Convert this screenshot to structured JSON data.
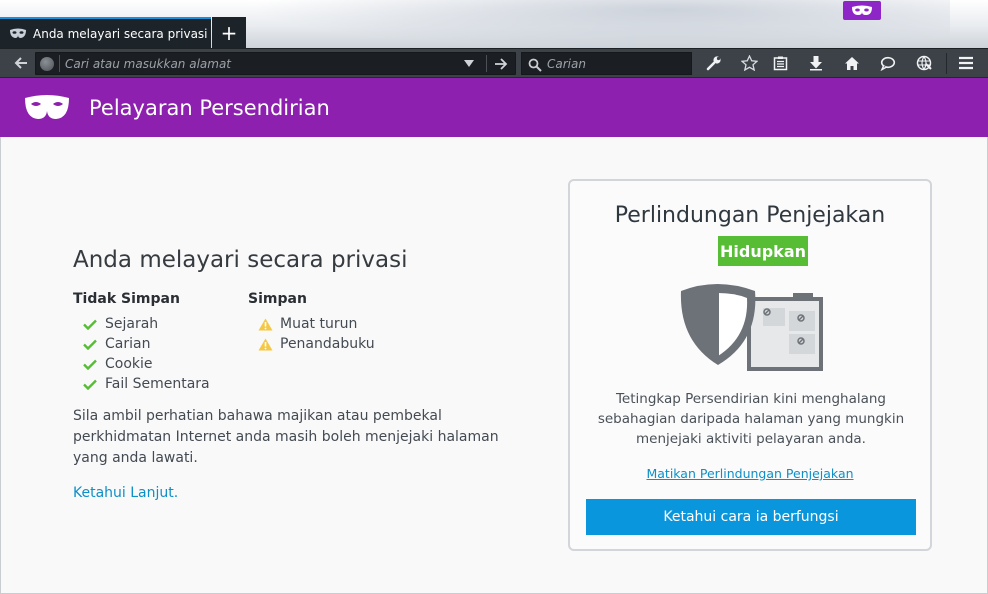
{
  "tab": {
    "title": "Anda melayari secara privasi",
    "close_glyph": "✕",
    "new_tab_glyph": "+"
  },
  "toolbar": {
    "url_placeholder": "Cari atau masukkan alamat",
    "search_placeholder": "Carian",
    "icons": [
      "back-icon",
      "globe-icon",
      "dropdown-icon",
      "go-arrow-icon",
      "search-icon",
      "wrench-icon",
      "star-icon",
      "reading-list-icon",
      "download-icon",
      "home-icon",
      "chat-icon",
      "globe-grid-icon",
      "menu-icon"
    ]
  },
  "header": {
    "title": "Pelayaran Persendirian"
  },
  "main": {
    "heading": "Anda melayari secara privasi",
    "not_saved": {
      "title": "Tidak Simpan",
      "items": [
        "Sejarah",
        "Carian",
        "Cookie",
        "Fail Sementara"
      ]
    },
    "saved": {
      "title": "Simpan",
      "items": [
        "Muat turun",
        "Penandabuku"
      ]
    },
    "note": "Sila ambil perhatian bahawa majikan atau pembekal perkhidmatan Internet anda masih boleh menjejaki halaman yang anda lawati.",
    "learn_more": "Ketahui Lanjut."
  },
  "tracking": {
    "title": "Perlindungan Penjejakan",
    "status": "Hidupkan",
    "description": "Tetingkap Persendirian kini menghalang sebahagian daripada halaman yang mungkin menjejaki aktiviti pelayaran anda.",
    "disable_link": "Matikan Perlindungan Penjejakan",
    "button": "Ketahui cara ia berfungsi"
  },
  "colors": {
    "accent_purple": "#8d20ae",
    "link_blue": "#0d8fc7",
    "button_blue": "#0996dd",
    "status_green": "#57bd35",
    "check_green": "#57bd35",
    "warning_yellow": "#f5c844"
  }
}
